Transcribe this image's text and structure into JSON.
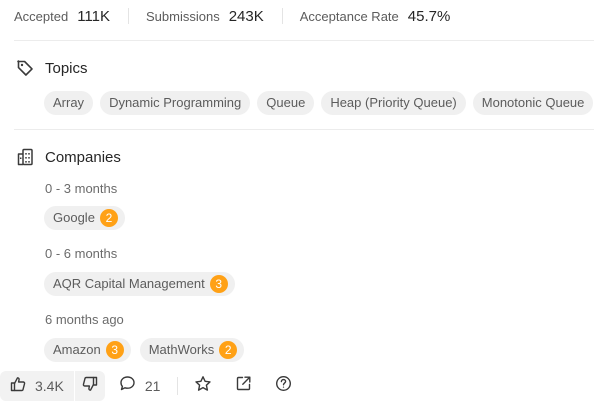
{
  "stats": {
    "accepted_label": "Accepted",
    "accepted_value": "111K",
    "submissions_label": "Submissions",
    "submissions_value": "243K",
    "acceptance_label": "Acceptance Rate",
    "acceptance_value": "45.7%"
  },
  "topics": {
    "title": "Topics",
    "icon": "tag-icon",
    "items": [
      "Array",
      "Dynamic Programming",
      "Queue",
      "Heap (Priority Queue)",
      "Monotonic Queue"
    ]
  },
  "companies": {
    "title": "Companies",
    "icon": "building-icon",
    "groups": [
      {
        "period": "0 - 3 months",
        "items": [
          {
            "name": "Google",
            "count": "2"
          }
        ]
      },
      {
        "period": "0 - 6 months",
        "items": [
          {
            "name": "AQR Capital Management",
            "count": "3"
          }
        ]
      },
      {
        "period": "6 months ago",
        "items": [
          {
            "name": "Amazon",
            "count": "3"
          },
          {
            "name": "MathWorks",
            "count": "2"
          }
        ]
      }
    ]
  },
  "bottom_bar": {
    "likes": "3.4K",
    "comments": "21",
    "icons": [
      "thumbs-up-icon",
      "thumbs-down-icon",
      "comment-icon",
      "star-icon",
      "share-icon",
      "help-icon"
    ]
  },
  "colors": {
    "badge": "#ffa116",
    "chip_background": "#f0f0f0",
    "text_primary": "#262626",
    "text_secondary": "#5c5c5c"
  }
}
